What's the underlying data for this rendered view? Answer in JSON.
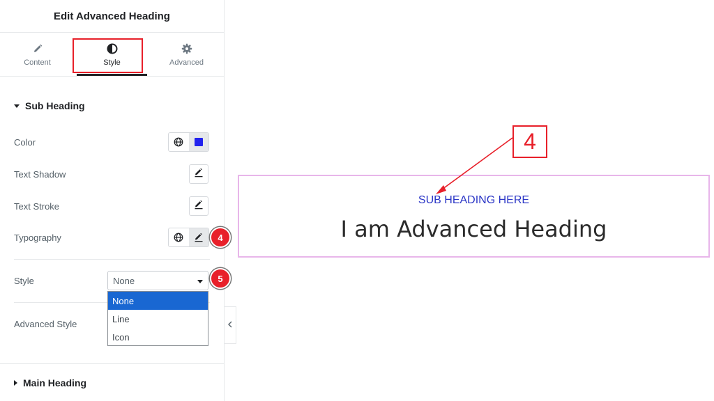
{
  "panel": {
    "title": "Edit Advanced Heading",
    "tabs": [
      {
        "label": "Content",
        "icon": "pencil-icon"
      },
      {
        "label": "Style",
        "icon": "contrast-icon"
      },
      {
        "label": "Advanced",
        "icon": "gear-icon"
      }
    ],
    "active_tab": "Style",
    "section": {
      "title": "Sub Heading",
      "controls": {
        "color": {
          "label": "Color",
          "swatch": "#2222ee"
        },
        "text_shadow": {
          "label": "Text Shadow"
        },
        "text_stroke": {
          "label": "Text Stroke"
        },
        "typography": {
          "label": "Typography"
        },
        "style": {
          "label": "Style",
          "value": "None",
          "options": [
            "None",
            "Line",
            "Icon"
          ]
        },
        "advanced_style": {
          "label": "Advanced Style"
        }
      }
    },
    "next_section": {
      "title": "Main Heading"
    }
  },
  "badges": {
    "typography": "4",
    "style": "5"
  },
  "canvas": {
    "sub_heading": "SUB HEADING HERE",
    "main_heading": "I am Advanced Heading",
    "callout": "4"
  },
  "colors": {
    "accent_red": "#e8202a",
    "selection_blue": "#1967d2",
    "sub_heading_blue": "#2a35c6",
    "widget_outline": "#e8b6ea"
  }
}
